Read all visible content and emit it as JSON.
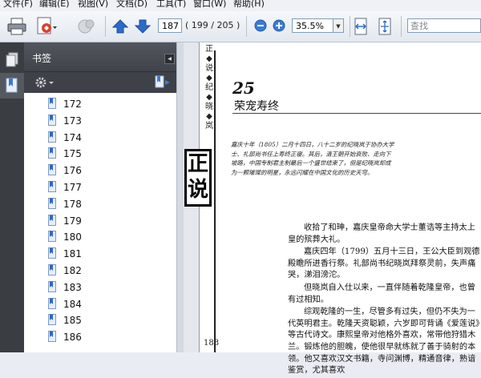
{
  "menu": [
    {
      "label": "文件(F)"
    },
    {
      "label": "编辑(E)"
    },
    {
      "label": "视图(V)"
    },
    {
      "label": "文档(D)"
    },
    {
      "label": "工具(T)"
    },
    {
      "label": "窗口(W)"
    },
    {
      "label": "帮助(H)"
    }
  ],
  "toolbar": {
    "current_page": "187",
    "page_count": "( 199 / 205 )",
    "zoom": "35.5%",
    "search_placeholder": "查找"
  },
  "panel": {
    "title": "书签"
  },
  "bookmarks": [
    "172",
    "173",
    "174",
    "175",
    "176",
    "177",
    "178",
    "179",
    "180",
    "181",
    "182",
    "183",
    "184",
    "185",
    "186"
  ],
  "page": {
    "running_head": "正◆说◆纪◆晓◆岚",
    "big_title": "正说",
    "chapter_number": "25",
    "chapter_title": "荣宠寿终",
    "intro": "嘉庆十年（1805）二月十四日，八十二岁的纪晓岚于协办大学士、礼部尚书任上寿终正寝。其后，清王朝开始衰败、走向下坡路，中国专制君主制最后一个盛世结束了，但是纪晓岚却成为一颗璀璨的明星，永远闪耀在中国文化的历史天穹。",
    "paragraphs": [
      "收拾了和珅，嘉庆皇帝命大学士董诰等主持太上皇的殡葬大礼。",
      "嘉庆四年（1799）五月十三日，王公大臣到观德殿瞻所进香行祭。礼部尚书纪晓岚拜祭灵前，失声痛哭，涕泪滂沱。",
      "但晓岚自入仕以来，一直伴随着乾隆皇帝，也曾有过相知。",
      "综观乾隆的一生，尽管多有过失，但仍不失为一代英明君主。乾隆天资聪颖，六岁即可背诵《爱莲说》等古代诗文。康熙皇帝对他格外喜欢，常带他狩猎木兰。锻炼他的胆魄，使他很早就练就了善于骑射的本领。他又喜欢汉文书籍，寺问渊博，精通音律，熟谙鉴赏，尤其喜欢"
    ],
    "page_number": "188"
  }
}
